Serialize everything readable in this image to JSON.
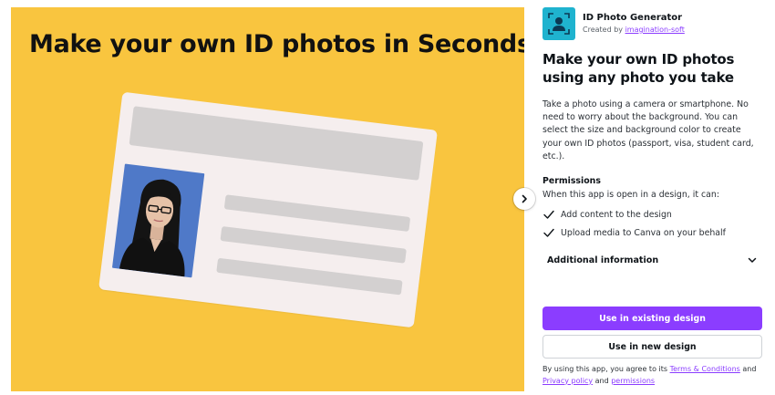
{
  "hero": {
    "title": "Make your own ID photos in Seconds",
    "background": "#f9c53f"
  },
  "app": {
    "icon": "id-photo-generator-logo",
    "name": "ID Photo Generator",
    "created_by_prefix": "Created by",
    "creator": "imagination-soft",
    "headline": "Make your own ID photos using any photo you take",
    "description": "Take a photo using a camera or smartphone. No need to worry about the background. You can select the size and background color to create your own ID photos (passport, visa, student card, etc.)."
  },
  "permissions": {
    "title": "Permissions",
    "intro": "When this app is open in a design, it can:",
    "items": [
      {
        "icon": "check-icon",
        "label": "Add content to the design"
      },
      {
        "icon": "check-icon",
        "label": "Upload media to Canva on your behalf"
      }
    ]
  },
  "additional_info": {
    "label": "Additional information",
    "icon": "chevron-down-icon"
  },
  "buttons": {
    "primary": "Use in existing design",
    "secondary": "Use in new design"
  },
  "legal": {
    "prefix": "By using this app, you agree to its",
    "terms": "Terms & Conditions",
    "and1": "and",
    "privacy": "Privacy policy",
    "and2": "and",
    "permissions": "permissions"
  },
  "colors": {
    "accent": "#8b3dff",
    "app_icon": "#1fb3cf",
    "photo_background": "#4f79c8"
  }
}
